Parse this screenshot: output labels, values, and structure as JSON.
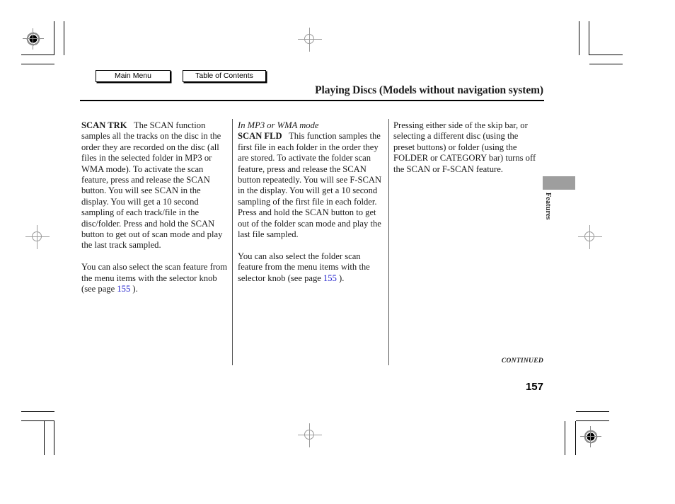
{
  "nav": {
    "main_menu_label": "Main Menu",
    "table_of_contents_label": "Table of Contents"
  },
  "header": {
    "title": "Playing Discs (Models without navigation system)"
  },
  "columns": {
    "col1": {
      "term": "SCAN TRK",
      "body": "The SCAN function samples all the tracks on the disc in the order they are recorded on the disc (all files in the selected folder in MP3 or WMA mode). To activate the scan feature, press and release the SCAN button. You will see SCAN in the display. You will get a 10 second sampling of each track/file in the disc/folder. Press and hold the SCAN button to get out of scan mode and play the last track sampled.",
      "para2_before": "You can also select the scan feature from the menu items with the selector knob (see page ",
      "para2_pageref": "155",
      "para2_after": " )."
    },
    "col2": {
      "mode_label": "In MP3 or WMA mode",
      "term": "SCAN FLD",
      "body": "This function samples the first file in each folder in the order they are stored. To activate the folder scan feature, press and release the SCAN button repeatedly. You will see F-SCAN in the display. You will get a 10 second sampling of the first file in each folder. Press and hold the SCAN button to get out of the folder scan mode and play the last file sampled.",
      "para2_before": "You can also select the folder scan feature from the menu items with the selector knob (see page ",
      "para2_pageref": "155",
      "para2_after": " )."
    },
    "col3": {
      "body": "Pressing either side of the skip bar, or selecting a different disc (using the preset buttons) or folder (using the FOLDER or CATEGORY bar) turns off the SCAN or F-SCAN feature."
    }
  },
  "side_tab": {
    "label": "Features"
  },
  "footer": {
    "continued": "CONTINUED",
    "page_number": "157"
  },
  "colors": {
    "page_reference_link": "#2222cc",
    "side_tab_block": "#9e9e9e",
    "rule": "#000000"
  }
}
